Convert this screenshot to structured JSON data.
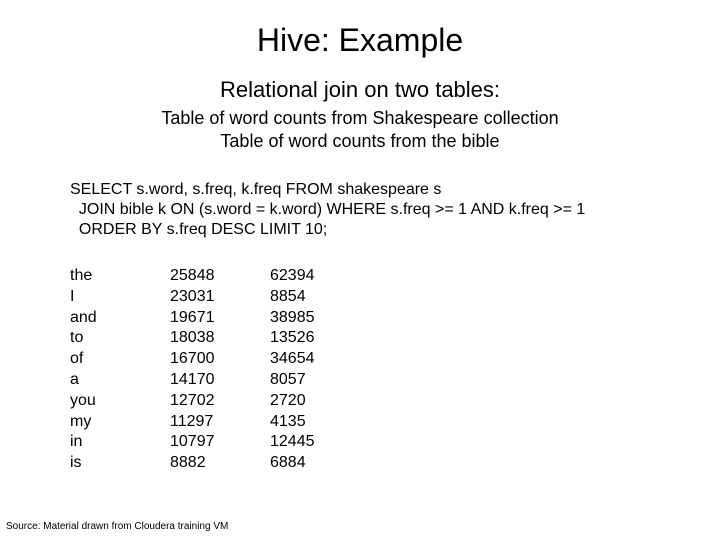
{
  "title": "Hive: Example",
  "subtitle": "Relational join on two tables:",
  "desc_line1": "Table of word counts from Shakespeare collection",
  "desc_line2": "Table of word counts from the bible",
  "sql_line1": "SELECT s.word, s.freq, k.freq FROM shakespeare s",
  "sql_line2": "  JOIN bible k ON (s.word = k.word) WHERE s.freq >= 1 AND k.freq >= 1",
  "sql_line3": "  ORDER BY s.freq DESC LIMIT 10;",
  "results": {
    "words": [
      "the",
      "I",
      "and",
      "to",
      "of",
      "a",
      "you",
      "my",
      "in",
      "is"
    ],
    "sfreq": [
      "25848",
      "23031",
      "19671",
      "18038",
      "16700",
      "14170",
      "12702",
      "11297",
      "10797",
      "8882"
    ],
    "kfreq": [
      "62394",
      "8854",
      "38985",
      "13526",
      "34654",
      "8057",
      "2720",
      "4135",
      "12445",
      "6884"
    ]
  },
  "source": "Source: Material drawn from Cloudera training VM"
}
